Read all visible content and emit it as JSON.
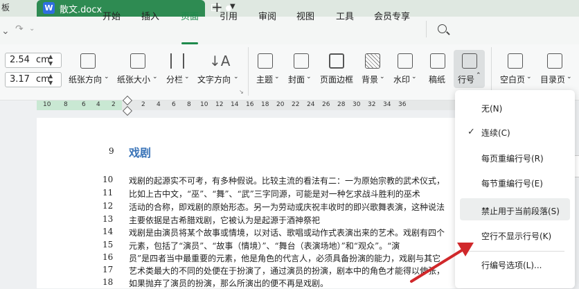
{
  "tabs": {
    "prev_label": "板",
    "active_title": "散文.docx",
    "new_tab": "+"
  },
  "menu": {
    "items": [
      "开始",
      "插入",
      "页面",
      "引用",
      "审阅",
      "视图",
      "工具",
      "会员专享"
    ],
    "active": "页面"
  },
  "ribbon": {
    "margin_top": "2.54",
    "margin_bottom": "3.17",
    "unit": "cm",
    "buttons": [
      "纸张方向",
      "纸张大小",
      "分栏",
      "文字方向",
      "主题",
      "封面",
      "页面边框",
      "背景",
      "水印",
      "稿纸",
      "行号",
      "空白页",
      "目录页"
    ]
  },
  "ruler": {
    "left_ticks": [
      "10",
      "8",
      "6",
      "4",
      "2"
    ],
    "right_ticks": [
      "2",
      "4",
      "6",
      "8",
      "10",
      "12",
      "14",
      "16",
      "18",
      "20",
      "22",
      "24",
      "26",
      "28",
      "30",
      "32",
      "34",
      "36"
    ]
  },
  "document": {
    "heading_num": "9",
    "heading": "戏剧",
    "lines": [
      {
        "num": "10",
        "text": "戏剧的起源实不可考，有多种假说。比较主流的看法有二：一为原始宗教的武术仪式，"
      },
      {
        "num": "11",
        "text": "比如上古中文，“巫”、“舞”、“武”三字同源，可能是对一种乞求战斗胜利的巫术"
      },
      {
        "num": "12",
        "text": "活动的合称，即戏剧的原始形态。另一为劳动或庆祝丰收时的即兴歌舞表演，这种说法"
      },
      {
        "num": "13",
        "text": "主要依据是古希腊戏剧，它被认为是起源于酒神祭祀"
      },
      {
        "num": "14",
        "text": "戏剧是由演员将某个故事或情境，以对话、歌唱或动作式表演出来的艺术。戏剧有四个"
      },
      {
        "num": "15",
        "text": "元素，包括了“演员”、“故事（情境）”、“舞台（表演场地）”和“观众”。“演"
      },
      {
        "num": "16",
        "text": "员”是四者当中最重要的元素，他是角色的代言人，必须具备扮演的能力，戏剧与其它"
      },
      {
        "num": "17",
        "text": "艺术类最大的不同的处便在于扮演了，通过演员的扮演，剧本中的角色才能得以伸张，"
      },
      {
        "num": "18",
        "text": "如果抛弃了演员的扮演，那么所演出的便不再是戏剧。"
      }
    ]
  },
  "dropdown": {
    "items": [
      "无(N)",
      "连续(C)",
      "每页重编行号(R)",
      "每节重编行号(E)",
      "禁止用于当前段落(S)",
      "空行不显示行号(K)",
      "行编号选项(L)..."
    ],
    "checked": "连续(C)",
    "highlighted": "禁止用于当前段落(S)"
  },
  "colors": {
    "accent": "#1e8a4c",
    "tab_active": "#2e8b52",
    "heading": "#3a74b8",
    "arrow": "#d0282b"
  }
}
